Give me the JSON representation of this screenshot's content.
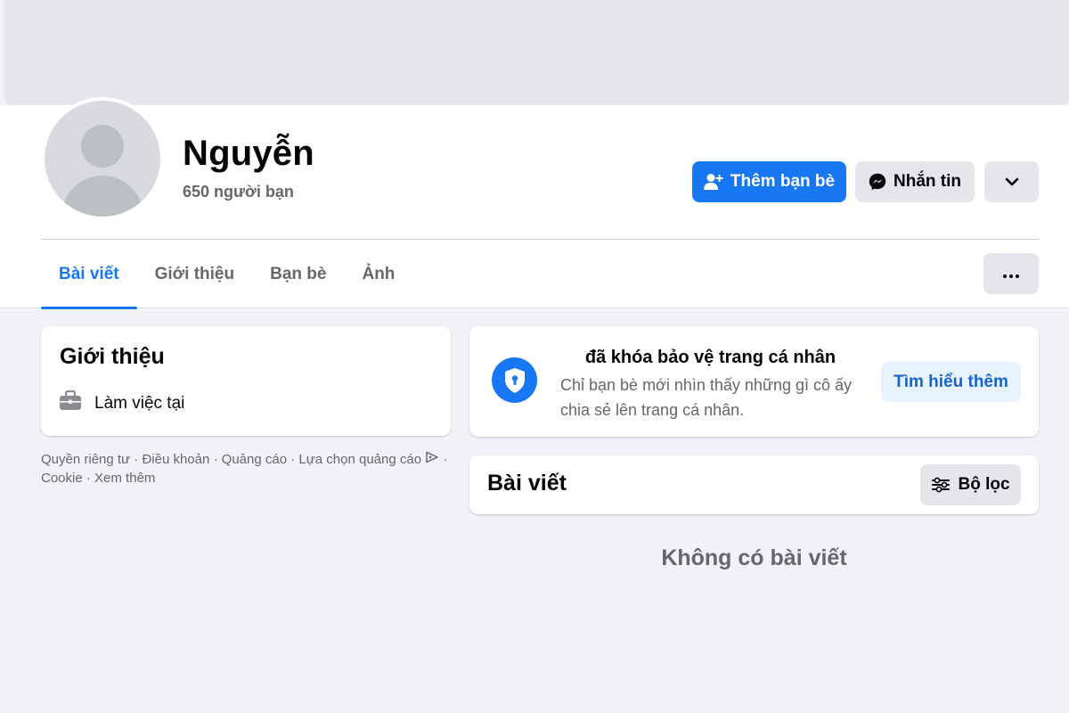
{
  "profile": {
    "name": "Nguyễn",
    "friends_count": "650 người bạn"
  },
  "actions": {
    "add_friend": "Thêm bạn bè",
    "message": "Nhắn tin"
  },
  "tabs": [
    {
      "label": "Bài viết",
      "active": true
    },
    {
      "label": "Giới thiệu",
      "active": false
    },
    {
      "label": "Bạn bè",
      "active": false
    },
    {
      "label": "Ảnh",
      "active": false
    }
  ],
  "intro": {
    "title": "Giới thiệu",
    "work": "Làm việc tại"
  },
  "footer": {
    "privacy": "Quyền riêng tư",
    "terms": "Điều khoản",
    "ads": "Quảng cáo",
    "ad_choices": "Lựa chọn quảng cáo",
    "cookie": "Cookie",
    "more": "Xem thêm",
    "sep": " · "
  },
  "lock_notice": {
    "title": "đã khóa bảo vệ trang cá nhân",
    "description": "Chỉ bạn bè mới nhìn thấy những gì cô ấy chia sẻ lên trang cá nhân.",
    "learn_more": "Tìm hiểu thêm"
  },
  "posts": {
    "title": "Bài viết",
    "filter": "Bộ lọc",
    "empty": "Không có bài viết"
  },
  "colors": {
    "accent": "#1877F2",
    "background": "#F0F2F5",
    "secondary_text": "#65676B"
  }
}
